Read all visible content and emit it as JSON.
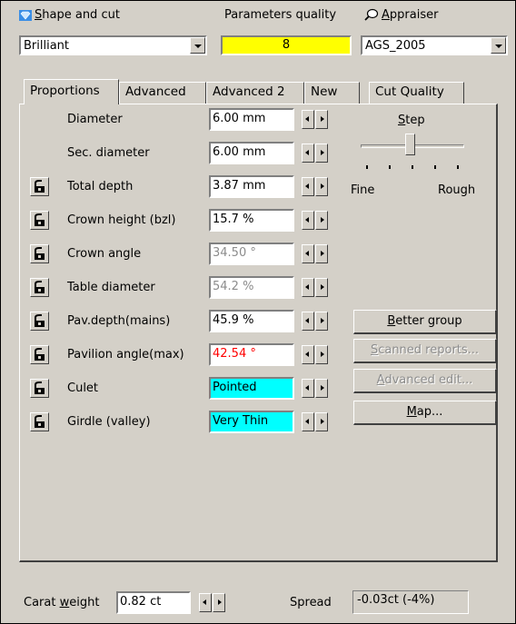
{
  "header": {
    "shape_label": "Shape and cut",
    "shape_value": "Brilliant",
    "quality_label": "Parameters quality",
    "quality_value": "8",
    "appraiser_label": "Appraiser",
    "appraiser_value": "AGS_2005"
  },
  "tabs": [
    "Proportions",
    "Advanced",
    "Advanced 2",
    "New",
    "Cut Quality"
  ],
  "active_tab": "Proportions",
  "params": [
    {
      "label": "Diameter",
      "value": "6.00 mm",
      "lock": false
    },
    {
      "label": "Sec. diameter",
      "value": "6.00 mm",
      "lock": false
    },
    {
      "label": "Total depth",
      "value": "3.87 mm",
      "lock": true
    },
    {
      "label": "Crown height (bzl)",
      "value": "15.7 %",
      "lock": true
    },
    {
      "label": "Crown angle",
      "value": "34.50 °",
      "lock": true,
      "state": "disabled"
    },
    {
      "label": "Table diameter",
      "value": "54.2 %",
      "lock": true,
      "state": "disabled"
    },
    {
      "label": "Pav.depth(mains)",
      "value": "45.9 %",
      "lock": true
    },
    {
      "label": "Pavilion angle(max)",
      "value": "42.54 °",
      "lock": true,
      "state": "warning"
    },
    {
      "label": "Culet",
      "value": "Pointed",
      "lock": true,
      "state": "highlight"
    },
    {
      "label": "Girdle (valley)",
      "value": "Very Thin",
      "lock": true,
      "state": "highlight"
    }
  ],
  "step": {
    "label": "Step",
    "min_label": "Fine",
    "max_label": "Rough",
    "position": 0.5
  },
  "buttons": {
    "better_group": "Better group",
    "scanned_reports": "Scanned reports...",
    "advanced_edit": "Advanced edit...",
    "map": "Map..."
  },
  "footer": {
    "carat_label": "Carat weight",
    "carat_value": "0.82 ct",
    "spread_label": "Spread",
    "spread_value": "-0.03ct (-4%)"
  },
  "colors": {
    "window_bg": "#d4d0c8",
    "quality_bg": "#ffff00",
    "highlight_bg": "#00ffff",
    "warning_text": "#ff0000",
    "disabled_text": "#8c8c8c"
  },
  "icons": {
    "shape": "diamond-icon",
    "appraiser": "magnifier-icon",
    "lock": "lock-toggle-icon"
  }
}
